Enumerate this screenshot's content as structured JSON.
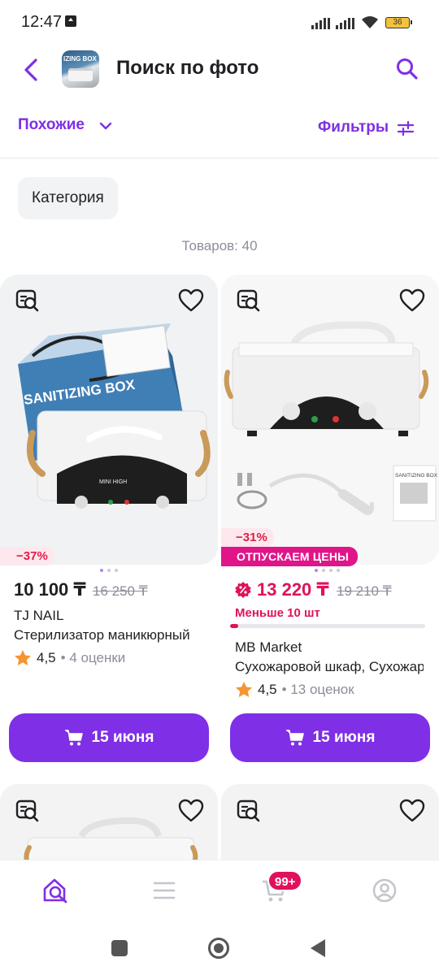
{
  "status_bar": {
    "time": "12:47",
    "battery": "36"
  },
  "header": {
    "title": "Поиск по фото",
    "thumb_text": "IZING BOX"
  },
  "toolbar": {
    "similar_label": "Похожие",
    "filters_label": "Фильтры"
  },
  "category_chip": "Категория",
  "results_count": "Товаров: 40",
  "products": [
    {
      "discount": "−37%",
      "price": "10 100 ₸",
      "old_price": "16 250 ₸",
      "seller": "TJ NAIL",
      "name": "Стерилизатор маникюрный",
      "rating": "4,5",
      "reviews": "• 4 оценки",
      "button": "15 июня",
      "image_text": "SANITIZING BOX"
    },
    {
      "discount": "−31%",
      "badge": "ОТПУСКАЕМ ЦЕНЫ",
      "price": "13 220 ₸",
      "old_price": "19 210 ₸",
      "stock": "Меньше 10 шт",
      "stock_level": 0.04,
      "seller": "MB Market",
      "name": "Сухожаровой шкаф, Сухожаровой",
      "rating": "4,5",
      "reviews": "• 13 оценок",
      "button": "15 июня",
      "image_text": "MINI HIGH TEMPERATURE STERILIZER",
      "image_text2": "SANITIZING BOX"
    }
  ],
  "bottom_nav": {
    "cart_badge": "99+"
  },
  "colors": {
    "accent": "#7f2fe6",
    "sale": "#e0115c",
    "badge": "#e0158a"
  }
}
